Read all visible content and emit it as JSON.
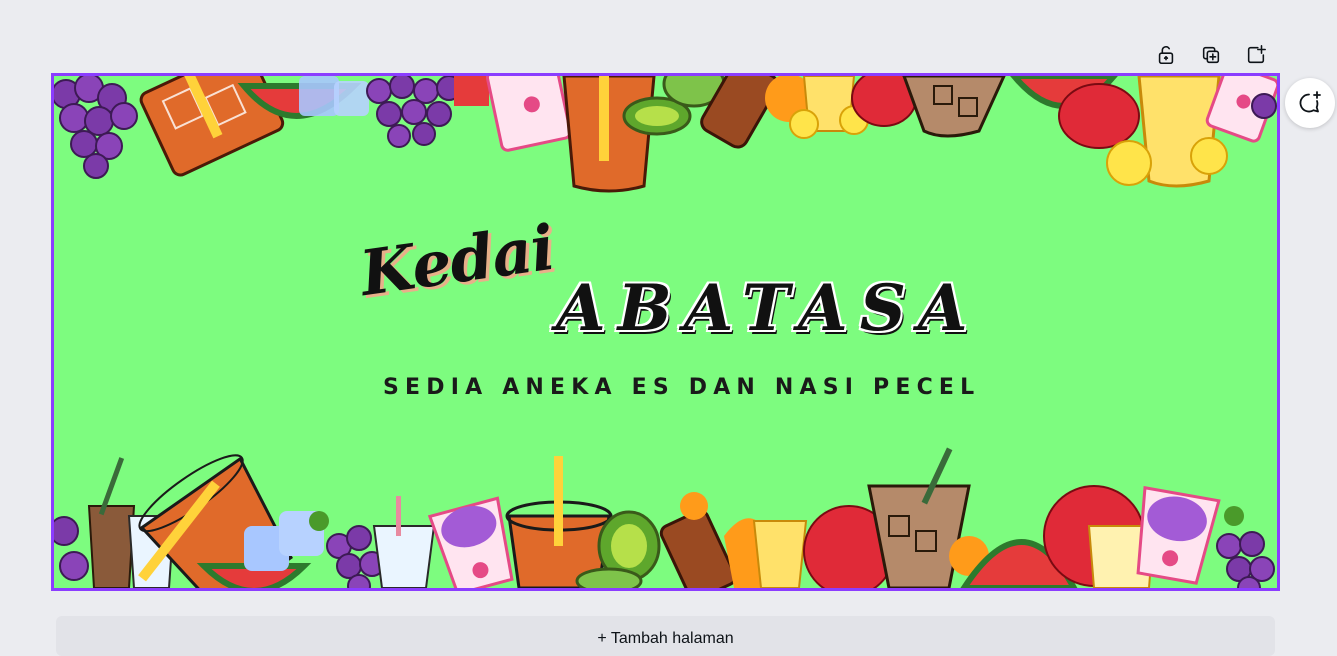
{
  "toolbar": {
    "icons": [
      "unlock-icon",
      "duplicate-page-icon",
      "add-page-icon"
    ]
  },
  "comment": {
    "icon": "add-comment-icon"
  },
  "design": {
    "background_color": "#7dfc7f",
    "selection_color": "#8b3dff",
    "headline_small": "Kedai",
    "headline_large": "ABATASA",
    "subtitle": "SEDIA ANEKA ES DAN NASI PECEL"
  },
  "add_page_label": "+ Tambah halaman"
}
